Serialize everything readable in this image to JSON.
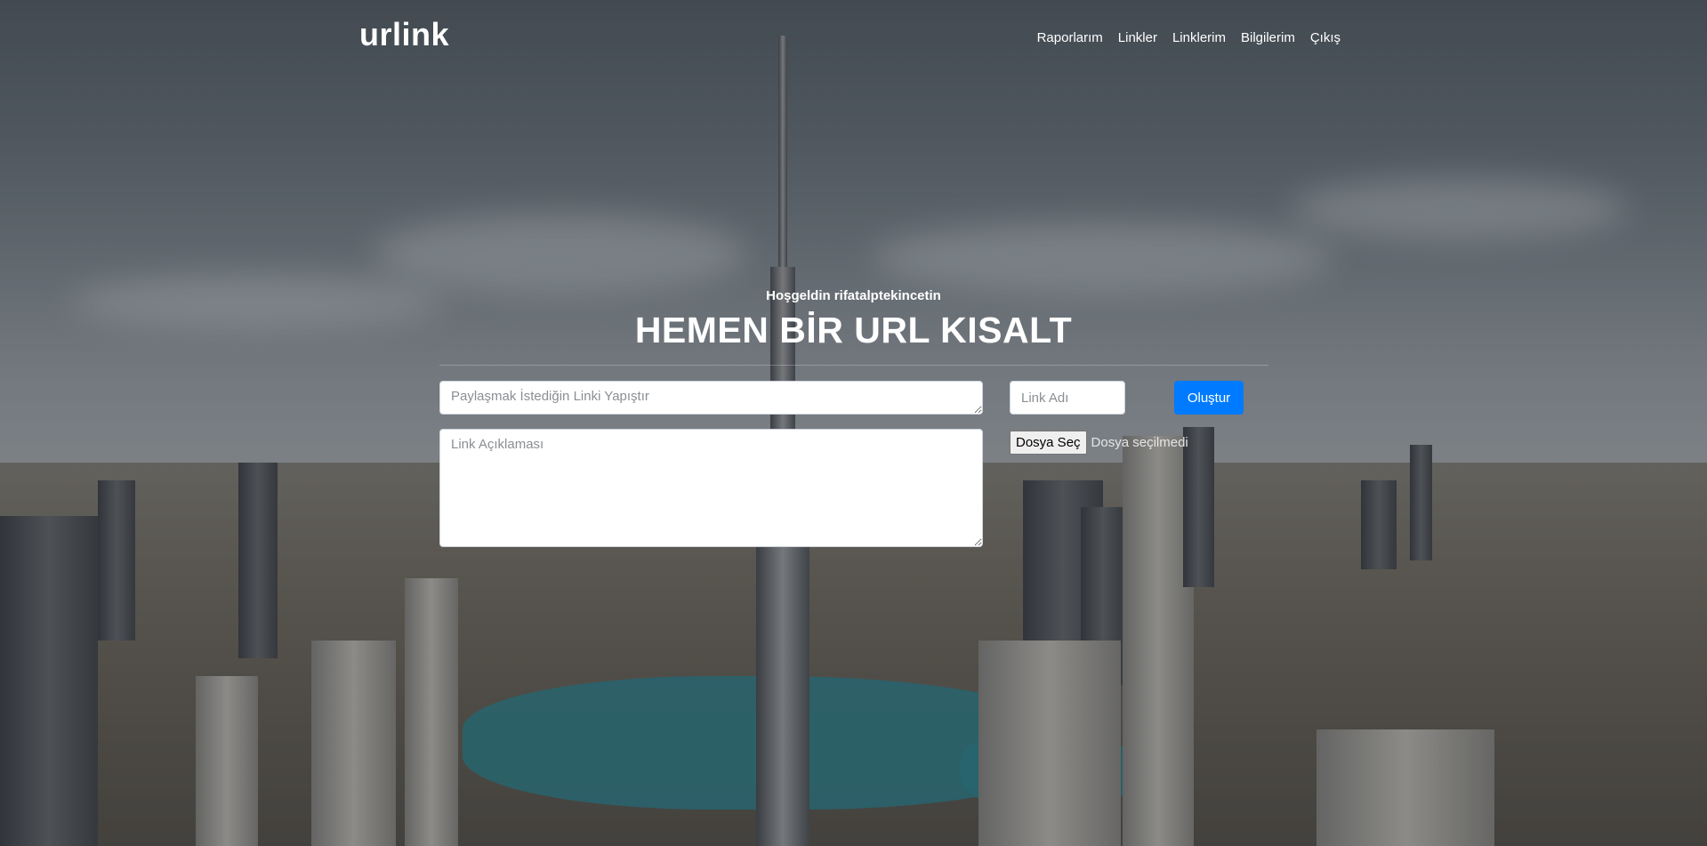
{
  "brand": "urlink",
  "nav": {
    "items": [
      "Raporlarım",
      "Linkler",
      "Linklerim",
      "Bilgilerim",
      "Çıkış"
    ]
  },
  "hero": {
    "welcome": "Hoşgeldin rifatalptekincetin",
    "headline": "HEMEN BİR URL KISALT"
  },
  "form": {
    "link_placeholder": "Paylaşmak İstediğin Linki Yapıştır",
    "description_placeholder": "Link Açıklaması",
    "name_placeholder": "Link Adı",
    "submit_label": "Oluştur",
    "file_button_label": "Dosya Seç",
    "file_status": "Dosya seçilmedi"
  },
  "colors": {
    "primary": "#007bff",
    "text_light": "#ffffff"
  }
}
